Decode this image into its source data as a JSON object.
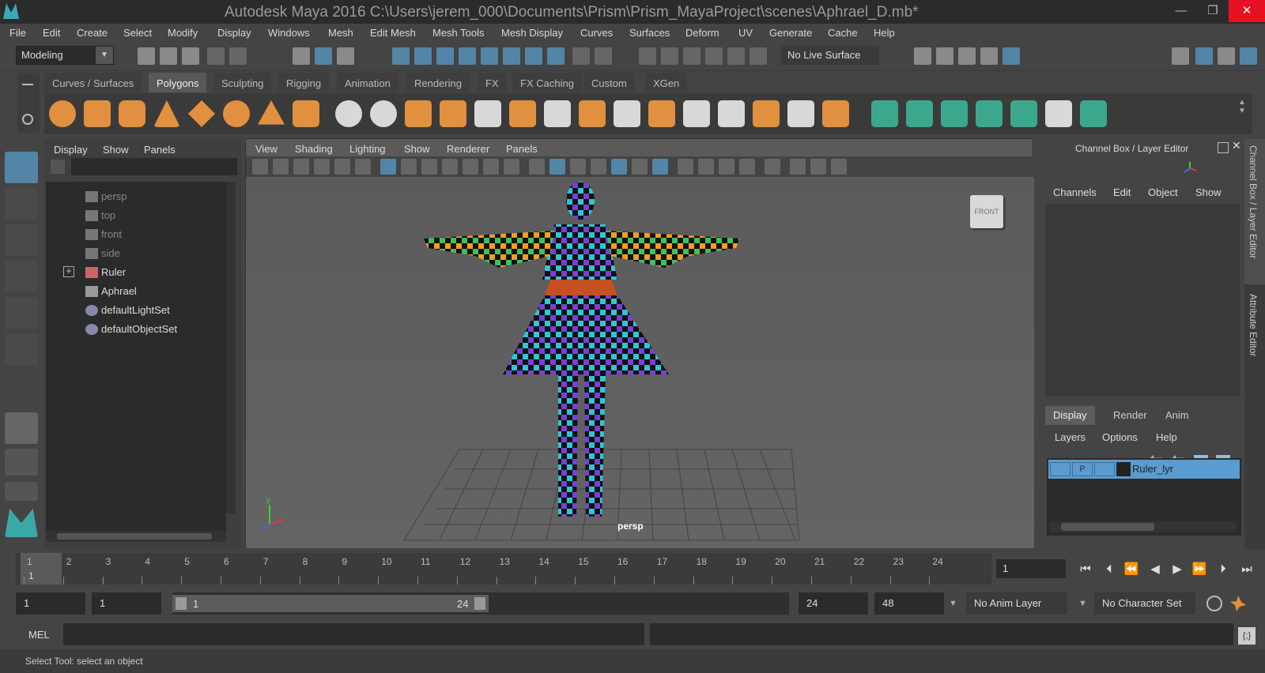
{
  "window": {
    "title": "Autodesk Maya 2016  C:\\Users\\jerem_000\\Documents\\Prism\\Prism_MayaProject\\scenes\\Aphrael_D.mb*",
    "minimize": "—",
    "maximize": "❐",
    "close": "✕"
  },
  "menubar": [
    "File",
    "Edit",
    "Create",
    "Select",
    "Modify",
    "Display",
    "Windows",
    "Mesh",
    "Edit Mesh",
    "Mesh Tools",
    "Mesh Display",
    "Curves",
    "Surfaces",
    "Deform",
    "UV",
    "Generate",
    "Cache",
    "Help"
  ],
  "statusline": {
    "mode": "Modeling",
    "live_surface": "No Live Surface"
  },
  "shelf": {
    "tabs": [
      "Curves / Surfaces",
      "Polygons",
      "Sculpting",
      "Rigging",
      "Animation",
      "Rendering",
      "FX",
      "FX Caching",
      "Custom",
      "XGen"
    ],
    "active_tab": "Polygons"
  },
  "outliner": {
    "menu": [
      "Display",
      "Show",
      "Panels"
    ],
    "items": [
      {
        "label": "persp",
        "type": "camera"
      },
      {
        "label": "top",
        "type": "camera"
      },
      {
        "label": "front",
        "type": "camera"
      },
      {
        "label": "side",
        "type": "camera"
      },
      {
        "label": "Ruler",
        "type": "object",
        "expand": "+"
      },
      {
        "label": "Aphrael",
        "type": "object"
      },
      {
        "label": "defaultLightSet",
        "type": "set"
      },
      {
        "label": "defaultObjectSet",
        "type": "set"
      }
    ]
  },
  "viewport": {
    "menu": [
      "View",
      "Shading",
      "Lighting",
      "Show",
      "Renderer",
      "Panels"
    ],
    "camera_label": "persp",
    "viewcube_label": "FRONT",
    "axis_y": "y"
  },
  "channelbox": {
    "title": "Channel Box / Layer Editor",
    "menu": [
      "Channels",
      "Edit",
      "Object",
      "Show"
    ]
  },
  "sidetabs": [
    "Channel Box / Layer Editor",
    "Attribute Editor"
  ],
  "layer_editor": {
    "tabs": [
      "Display",
      "Render",
      "Anim"
    ],
    "active_tab": "Display",
    "menu": [
      "Layers",
      "Options",
      "Help"
    ],
    "layers": [
      {
        "name": "Ruler_lyr",
        "playback": "P"
      }
    ]
  },
  "timeline": {
    "ticks": [
      "1",
      "2",
      "3",
      "4",
      "5",
      "6",
      "7",
      "8",
      "9",
      "10",
      "11",
      "12",
      "13",
      "14",
      "15",
      "16",
      "17",
      "18",
      "19",
      "20",
      "21",
      "22",
      "23",
      "24"
    ],
    "current_marker": "1",
    "current_frame": "1"
  },
  "range": {
    "start_time": "1",
    "playback_start": "1",
    "range_start": "1",
    "range_end": "24",
    "playback_end": "24",
    "end_time": "48",
    "anim_layer": "No Anim Layer",
    "character_set": "No Character Set"
  },
  "commandline": {
    "label": "MEL"
  },
  "status": {
    "help_text": "Select Tool: select an object"
  },
  "colors": {
    "accent": "#5285a6",
    "layer_highlight": "#5a9bd0",
    "shelf_orange": "#e0903e",
    "shelf_teal": "#3ba88e",
    "close_red": "#e81123"
  }
}
